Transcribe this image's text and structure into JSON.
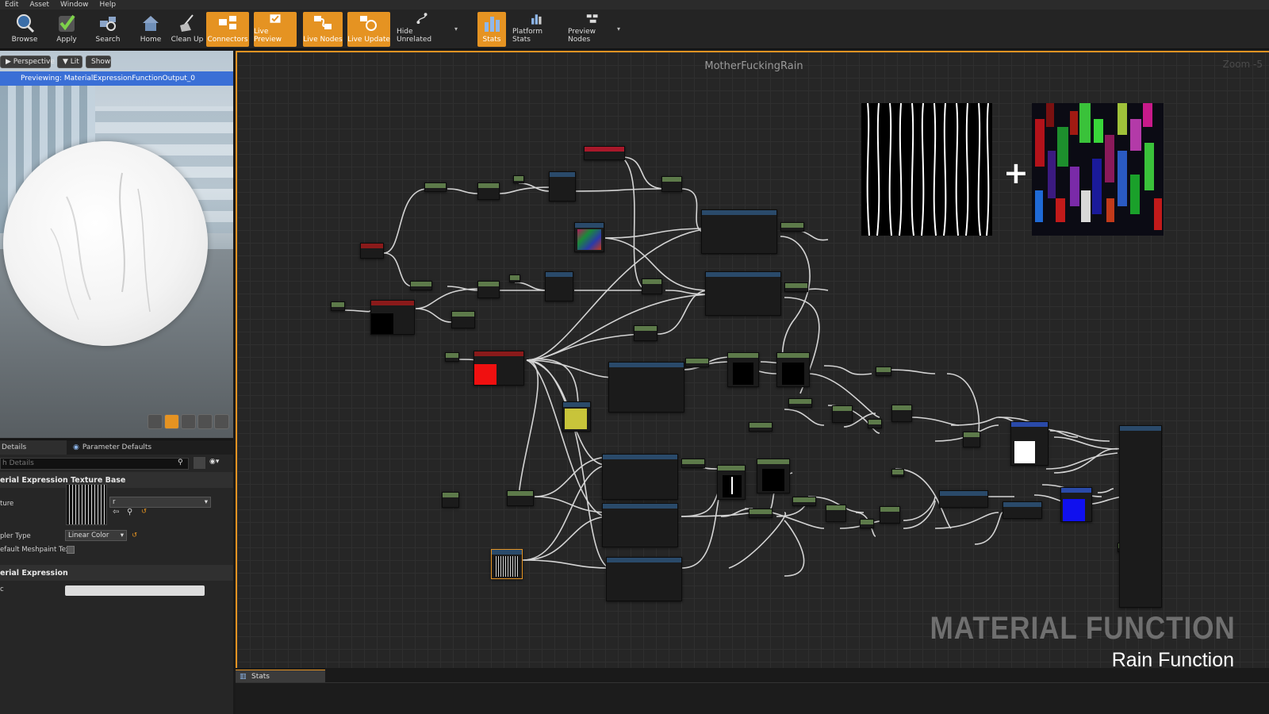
{
  "menu": [
    "Edit",
    "Asset",
    "Window",
    "Help"
  ],
  "toolbar": {
    "browse": "Browse",
    "apply": "Apply",
    "search": "Search",
    "home": "Home",
    "cleanup": "Clean Up",
    "connectors": "Connectors",
    "live_preview": "Live Preview",
    "live_nodes": "Live Nodes",
    "live_update": "Live Update",
    "hide_unrelated": "Hide Unrelated",
    "stats": "Stats",
    "platform_stats": "Platform Stats",
    "preview_nodes": "Preview Nodes"
  },
  "viewport": {
    "perspective": "Perspective",
    "lit": "Lit",
    "show": "Show",
    "previewing": "Previewing: MaterialExpressionFunctionOutput_0"
  },
  "details": {
    "tab_details": "Details",
    "tab_params": "Parameter Defaults",
    "search_placeholder": "h Details",
    "cat_texture_base": "erial Expression Texture Base",
    "texture_label": "ture",
    "texture_value": "r",
    "sampler_label": "pler Type",
    "sampler_value": "Linear Color",
    "meshpaint_label": "efault Meshpaint Tex",
    "cat_expression": "erial Expression",
    "desc_label": "c"
  },
  "graph": {
    "title": "MotherFuckingRain",
    "zoom": "Zoom -5",
    "watermark_title": "MATERIAL FUNCTION",
    "watermark_sub": "Rain Function"
  },
  "bottom": {
    "stats_tab": "Stats"
  },
  "colors": {
    "accent": "#e59322",
    "preview_bar": "#3a6fd6"
  }
}
